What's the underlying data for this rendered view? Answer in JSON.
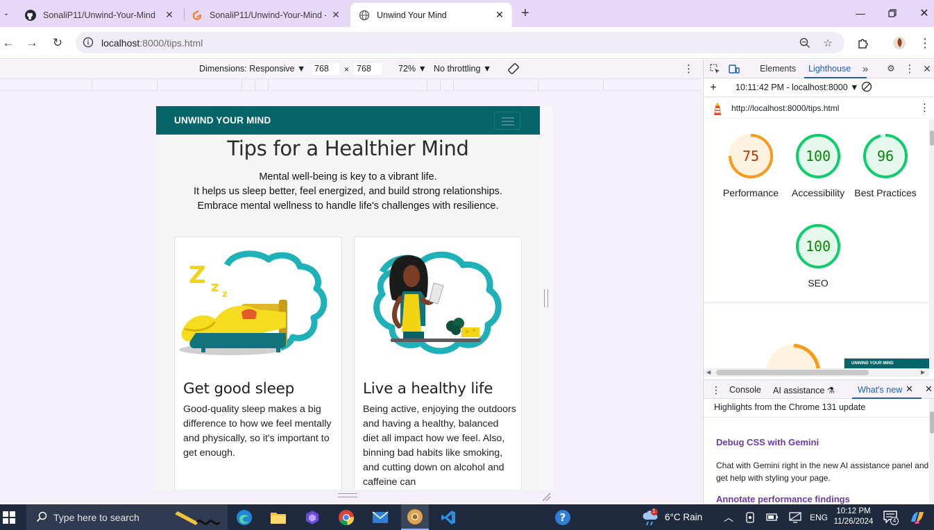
{
  "browser": {
    "tabs": [
      {
        "title": "SonaliP11/Unwind-Your-Mind",
        "icon": "github-icon"
      },
      {
        "title": "SonaliP11/Unwind-Your-Mind -",
        "icon": "gitpod-icon"
      },
      {
        "title": "Unwind Your Mind",
        "icon": "globe-icon"
      }
    ],
    "url_host": "localhost",
    "url_rest": ":8000/tips.html"
  },
  "device_toolbar": {
    "dimensions_label": "Dimensions: Responsive ▼",
    "width": "768",
    "height": "768",
    "times": "×",
    "zoom": "72% ▼",
    "throttle": "No throttling ▼"
  },
  "site": {
    "brand": "UNWIND YOUR MIND",
    "title": "Tips for a Healthier Mind",
    "intro": [
      "Mental well-being is key to a vibrant life.",
      "It helps us sleep better, feel energized, and build strong relationships.",
      "Embrace mental wellness to handle life's challenges with resilience."
    ],
    "cards": [
      {
        "title": "Get good sleep",
        "text": "Good-quality sleep makes a big difference to how we feel mentally and physically, so it's important to get enough."
      },
      {
        "title": "Live a healthy life",
        "text": "Being active, enjoying the outdoors and having a healthy, balanced diet all impact how we feel. Also, binning bad habits like smoking, and cutting down on alcohol and caffeine can"
      }
    ]
  },
  "devtools": {
    "tabs": {
      "elements": "Elements",
      "lighthouse": "Lighthouse"
    },
    "report_time": "10:11:42 PM - localhost:8000 ▼",
    "report_url": "http://localhost:8000/tips.html",
    "scores": [
      {
        "label": "Performance",
        "value": 75,
        "color": "#fa9a1a",
        "fill": "#fff3e0",
        "text_color": "#c33300"
      },
      {
        "label": "Accessibility",
        "value": 100,
        "color": "#0cce6b",
        "fill": "#e6f8ee",
        "text_color": "#008800"
      },
      {
        "label": "Best Practices",
        "value": 96,
        "color": "#0cce6b",
        "fill": "#e6f8ee",
        "text_color": "#008800"
      },
      {
        "label": "SEO",
        "value": 100,
        "color": "#0cce6b",
        "fill": "#e6f8ee",
        "text_color": "#008800"
      }
    ],
    "drawer_tabs": {
      "console": "Console",
      "ai": "AI assistance",
      "whats_new": "What's new"
    },
    "whats_new": {
      "heading": "Highlights from the Chrome 131 update",
      "item1_title": "Debug CSS with Gemini",
      "item1_text": "Chat with Gemini right in the new AI assistance panel and get help with styling your page.",
      "item2_title": "Annotate performance findings"
    }
  },
  "taskbar": {
    "search_placeholder": "Type here to search",
    "weather": "6°C  Rain",
    "lang": "ENG",
    "time": "10:12 PM",
    "date": "11/26/2024",
    "notif_count": "4",
    "weather_badge": "1"
  }
}
